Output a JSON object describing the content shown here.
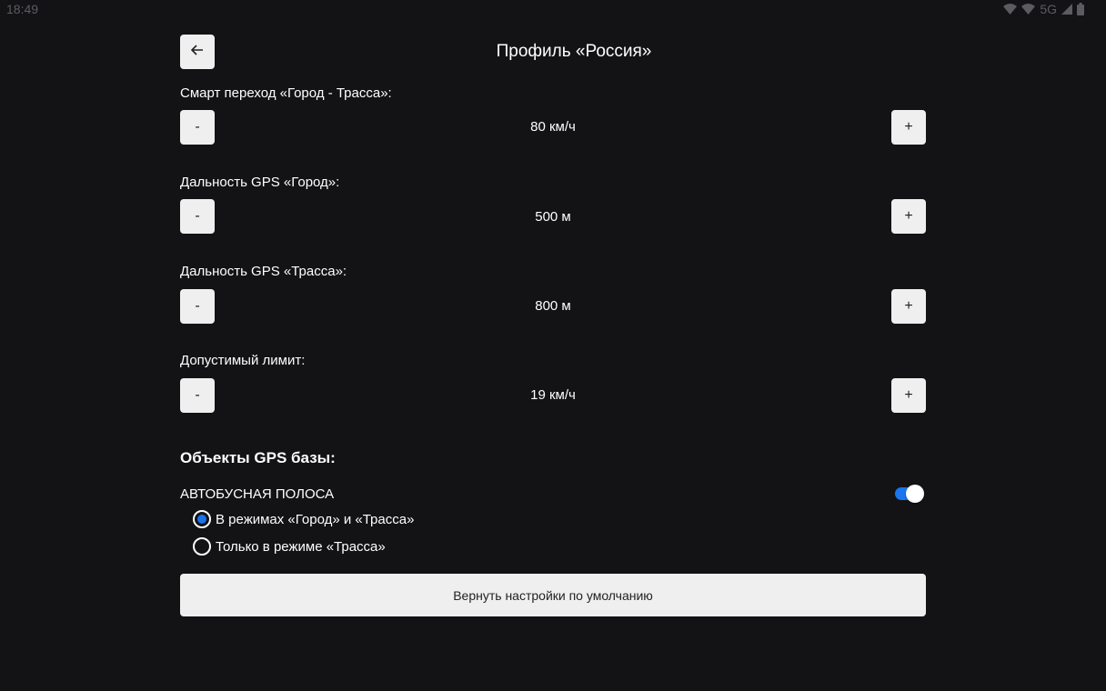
{
  "status_bar": {
    "time": "18:49",
    "network": "5G",
    "icons": [
      "wifi-icon",
      "wifi-icon",
      "signal-icon",
      "battery-icon"
    ]
  },
  "header": {
    "back_icon": "arrow-left-icon",
    "title": "Профиль «Россия»"
  },
  "settings": [
    {
      "label": "Смарт переход «Город - Трасса»:",
      "value": "80 км/ч",
      "minus": "-",
      "plus": "+"
    },
    {
      "label": "Дальность GPS «Город»:",
      "value": "500 м",
      "minus": "-",
      "plus": "+"
    },
    {
      "label": "Дальность GPS «Трасса»:",
      "value": "800 м",
      "minus": "-",
      "plus": "+"
    },
    {
      "label": "Допустимый лимит:",
      "value": "19 км/ч",
      "minus": "-",
      "plus": "+"
    }
  ],
  "gps_objects": {
    "title": "Объекты GPS базы:",
    "option_label": "АВТОБУСНАЯ ПОЛОСА",
    "toggle_on": true,
    "modes": [
      {
        "label": "В режимах «Город» и «Трасса»",
        "selected": true
      },
      {
        "label": "Только в режиме «Трасса»",
        "selected": false
      }
    ]
  },
  "reset_button": "Вернуть настройки по умолчанию",
  "colors": {
    "background": "#131316",
    "button": "#efefef",
    "accent": "#1976f0"
  }
}
